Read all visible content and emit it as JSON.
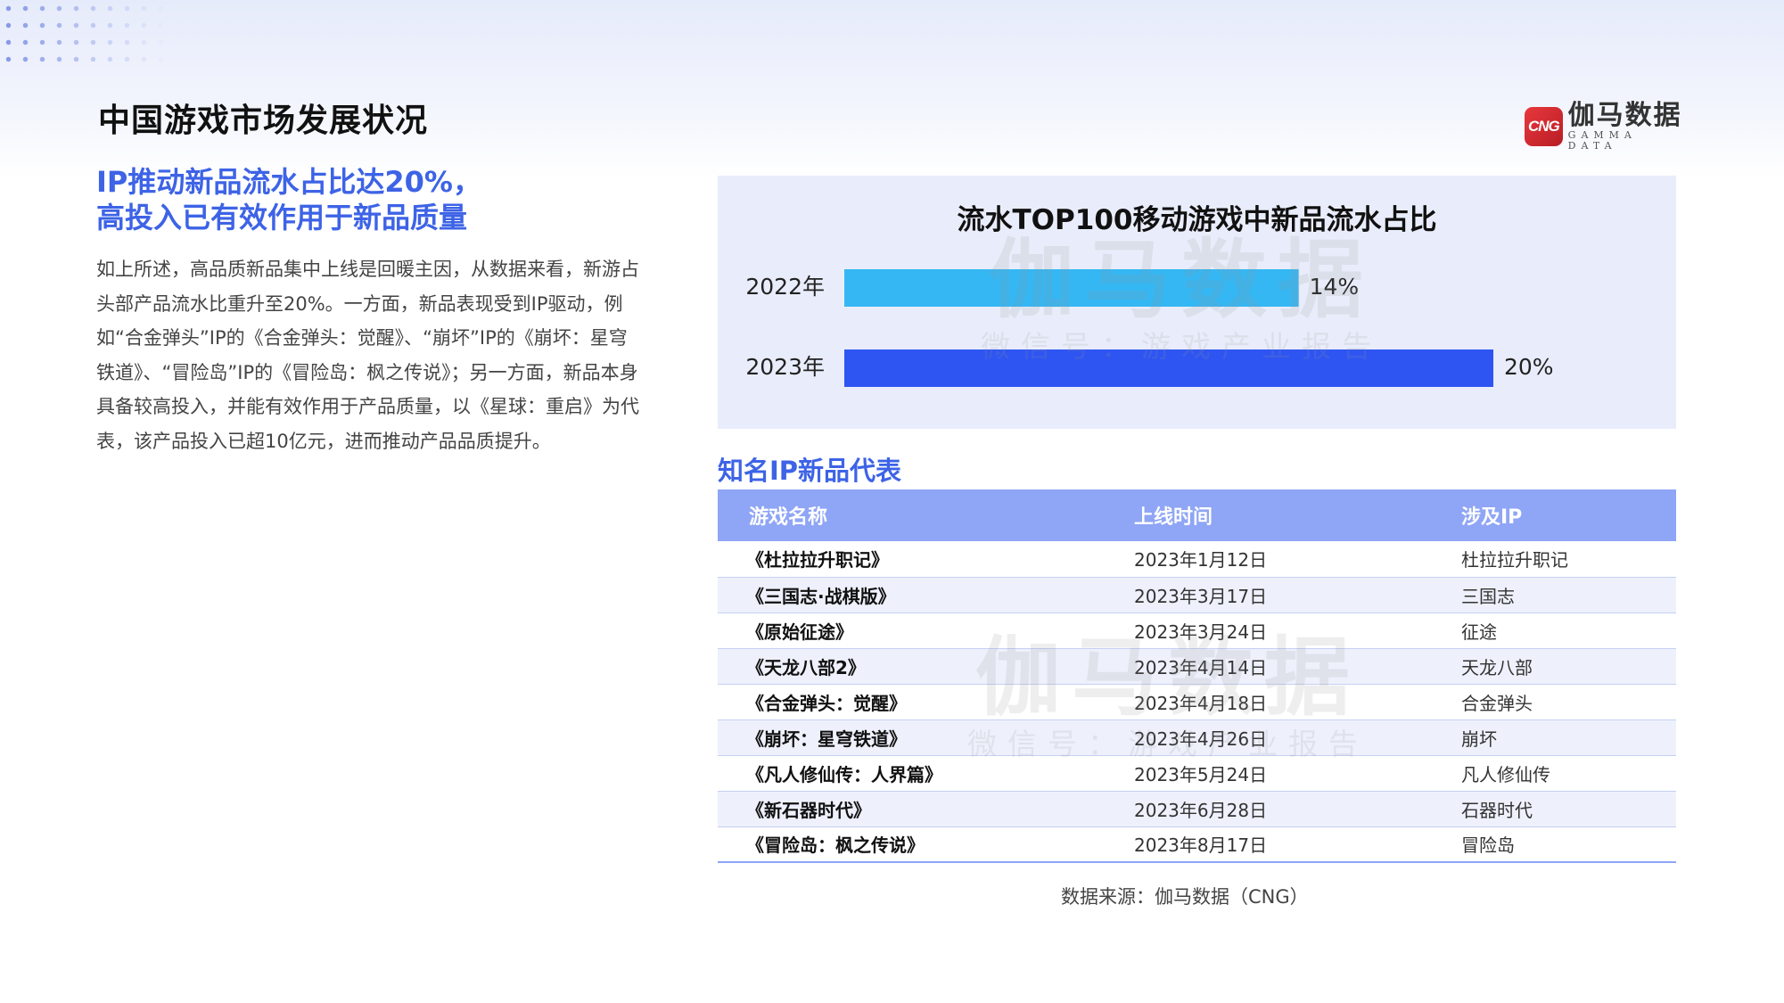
{
  "page_title": "中国游戏市场发展状况",
  "logo": {
    "mark": "CNG",
    "name_cn": "伽马数据",
    "name_en": "GAMMA DATA"
  },
  "headline": {
    "line1": "IP推动新品流水占比达20%，",
    "line2": "高投入已有效作用于新品质量"
  },
  "body_text": "如上所述，高品质新品集中上线是回暖主因，从数据来看，新游占头部产品流水比重升至20%。一方面，新品表现受到IP驱动，例如“合金弹头”IP的《合金弹头：觉醒》、“崩坏”IP的《崩坏：星穹铁道》、“冒险岛”IP的《冒险岛：枫之传说》；另一方面，新品本身具备较高投入，并能有效作用于产品质量，以《星球：重启》为代表，该产品投入已超10亿元，进而推动产品品质提升。",
  "watermark": {
    "big": "伽马数据",
    "small": "微信号：游戏产业报告"
  },
  "chart_data": {
    "type": "bar",
    "orientation": "horizontal",
    "title": "流水TOP100移动游戏中新品流水占比",
    "categories": [
      "2022年",
      "2023年"
    ],
    "values": [
      14,
      20
    ],
    "value_labels": [
      "14%",
      "20%"
    ],
    "colors": [
      "#35b7f3",
      "#2e55f2"
    ],
    "xlim": [
      0,
      20
    ],
    "grid": false,
    "legend": "none"
  },
  "ip_section": {
    "title": "知名IP新品代表",
    "headers": [
      "游戏名称",
      "上线时间",
      "涉及IP"
    ],
    "rows": [
      [
        "《杜拉拉升职记》",
        "2023年1月12日",
        "杜拉拉升职记"
      ],
      [
        "《三国志·战棋版》",
        "2023年3月17日",
        "三国志"
      ],
      [
        "《原始征途》",
        "2023年3月24日",
        "征途"
      ],
      [
        "《天龙八部2》",
        "2023年4月14日",
        "天龙八部"
      ],
      [
        "《合金弹头：觉醒》",
        "2023年4月18日",
        "合金弹头"
      ],
      [
        "《崩坏：星穹铁道》",
        "2023年4月26日",
        "崩坏"
      ],
      [
        "《凡人修仙传：人界篇》",
        "2023年5月24日",
        "凡人修仙传"
      ],
      [
        "《新石器时代》",
        "2023年6月28日",
        "石器时代"
      ],
      [
        "《冒险岛：枫之传说》",
        "2023年8月17日",
        "冒险岛"
      ]
    ]
  },
  "source": "数据来源：伽马数据（CNG）"
}
